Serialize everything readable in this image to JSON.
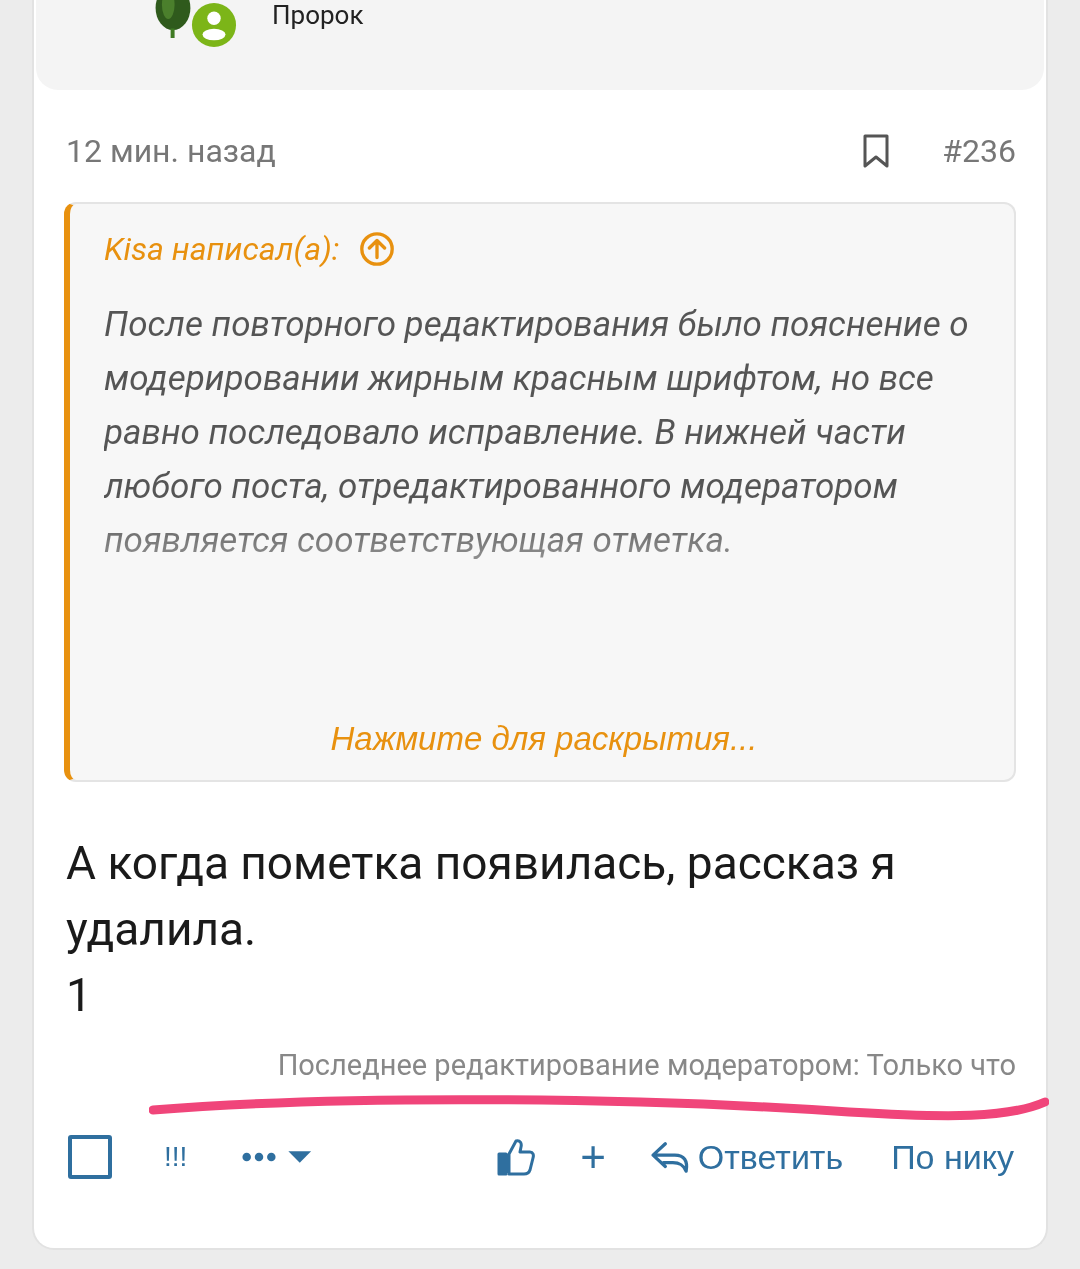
{
  "author": {
    "name": "Пророк"
  },
  "post": {
    "time": "12 мин. назад",
    "bookmarked": false,
    "number": "#236"
  },
  "quote": {
    "author": "Kisa написал(а):",
    "text": "После повторного редактирования было пояснение о модерировании жирным красным шрифтом, но все равно последовало исправление. В нижней части любого поста, отредактированного модератором появляется соответствующая отметка.",
    "expand": "Нажмите для раскрытия..."
  },
  "body": [
    "А когда пометка появилась, рассказ я удалила.",
    "1"
  ],
  "edited": "Последнее редактирование модератором: Только что",
  "actions": {
    "selected": false,
    "report": "!!!",
    "plus": "+",
    "reply": "Ответить",
    "by_nick": "По нику"
  }
}
